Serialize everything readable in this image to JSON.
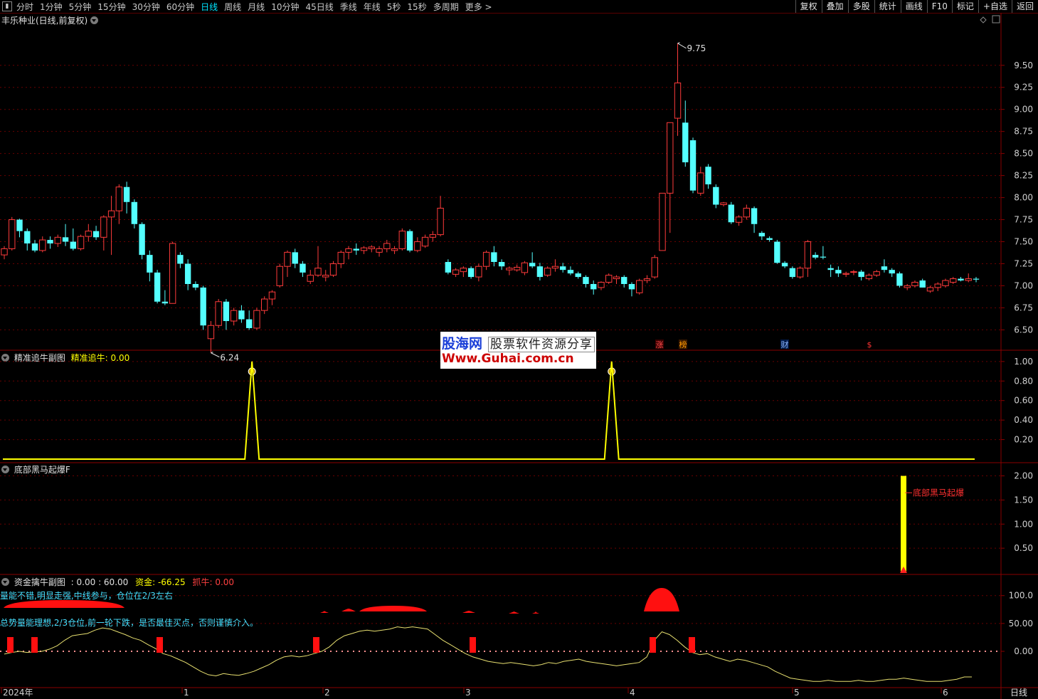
{
  "toolbar": {
    "left_items": [
      "分时",
      "1分钟",
      "5分钟",
      "15分钟",
      "30分钟",
      "60分钟",
      "日线",
      "周线",
      "月线",
      "10分钟",
      "45日线",
      "季线",
      "年线",
      "5秒",
      "15秒",
      "多周期",
      "更多 >"
    ],
    "active_item": "日线",
    "right_items": [
      "复权",
      "叠加",
      "多股",
      "统计",
      "画线",
      "F10",
      "标记",
      "+自选",
      "返回"
    ]
  },
  "main_panel": {
    "title": "丰乐种业(日线,前复权)",
    "high_label": "9.75",
    "low_label": "6.24",
    "event_markers": [
      {
        "text": "涨",
        "color": "#ff4d4d",
        "bg": "#3a0000"
      },
      {
        "text": "榜",
        "color": "#ff9900",
        "bg": "#3a1a00"
      },
      {
        "text": "财",
        "color": "#8fb7ff",
        "bg": "#001a4a"
      },
      {
        "text": "$",
        "color": "#ff3333",
        "bg": "#000000"
      }
    ]
  },
  "panel2": {
    "name": "精准追牛副图",
    "value_label": "精准追牛: 0.00",
    "axis_labels": [
      "1.00",
      "0.80",
      "0.60",
      "0.40",
      "0.20"
    ]
  },
  "panel3": {
    "name": "底部黑马起爆F",
    "annotation": "底部黑马起爆",
    "axis_labels": [
      "2.00",
      "1.50",
      "1.00",
      "0.50"
    ]
  },
  "panel4": {
    "name": "资金擒牛副图",
    "values_label": ": 0.00 : 60.00",
    "fund_label": "资金: -66.25",
    "catch_label": "抓牛: 0.00",
    "note1": "量能不错,明显走强,中线参与，仓位在2/3左右",
    "note2": "总势量能理想,2/3仓位,前一轮下跌，是否最佳买点，否则谨慎介入。",
    "axis_labels": [
      "100.0",
      "50.00",
      "0.00"
    ]
  },
  "x_axis": {
    "labels": [
      "2024年",
      "1",
      "2",
      "3",
      "4",
      "5",
      "6"
    ],
    "right_label": "日线"
  },
  "watermark": {
    "line1": "股海网",
    "line1b": "股票软件资源分享",
    "line2": "Www.Guhai.com.cn"
  },
  "colors": {
    "up": "#ff3b3b",
    "down": "#54ffff",
    "yellow": "#ffff00",
    "grid": "#6a0000",
    "axis_text": "#d0d0d0"
  },
  "chart_data": [
    {
      "type": "candlestick",
      "title": "丰乐种业(日线,前复权)",
      "y_ticks": [
        9.5,
        9.25,
        9.0,
        8.75,
        8.5,
        8.25,
        8.0,
        7.75,
        7.5,
        7.25,
        7.0,
        6.75,
        6.5
      ],
      "ylim": [
        6.35,
        9.95
      ],
      "high": 9.75,
      "low": 6.24,
      "ohlc": [
        [
          7.35,
          7.45,
          7.3,
          7.42
        ],
        [
          7.42,
          7.78,
          7.4,
          7.75
        ],
        [
          7.75,
          7.76,
          7.55,
          7.62
        ],
        [
          7.62,
          7.65,
          7.4,
          7.48
        ],
        [
          7.48,
          7.52,
          7.38,
          7.4
        ],
        [
          7.4,
          7.56,
          7.38,
          7.52
        ],
        [
          7.52,
          7.56,
          7.42,
          7.48
        ],
        [
          7.48,
          7.58,
          7.44,
          7.55
        ],
        [
          7.55,
          7.7,
          7.45,
          7.5
        ],
        [
          7.5,
          7.65,
          7.4,
          7.42
        ],
        [
          7.42,
          7.58,
          7.4,
          7.56
        ],
        [
          7.56,
          7.7,
          7.5,
          7.62
        ],
        [
          7.62,
          7.68,
          7.52,
          7.55
        ],
        [
          7.55,
          7.8,
          7.4,
          7.78
        ],
        [
          7.78,
          8.02,
          7.35,
          7.85
        ],
        [
          7.85,
          8.15,
          7.7,
          8.12
        ],
        [
          8.12,
          8.18,
          7.82,
          7.95
        ],
        [
          7.95,
          7.98,
          7.65,
          7.7
        ],
        [
          7.7,
          7.72,
          7.3,
          7.35
        ],
        [
          7.35,
          7.4,
          7.05,
          7.15
        ],
        [
          7.15,
          7.18,
          6.8,
          6.82
        ],
        [
          6.82,
          6.95,
          6.78,
          6.8
        ],
        [
          6.8,
          7.5,
          6.85,
          7.48
        ],
        [
          7.35,
          7.38,
          7.2,
          7.25
        ],
        [
          7.25,
          7.3,
          6.95,
          7.02
        ],
        [
          7.02,
          7.05,
          6.95,
          6.98
        ],
        [
          6.98,
          7.0,
          6.5,
          6.55
        ],
        [
          6.4,
          6.6,
          6.24,
          6.55
        ],
        [
          6.55,
          6.85,
          6.52,
          6.82
        ],
        [
          6.82,
          6.85,
          6.5,
          6.6
        ],
        [
          6.6,
          6.75,
          6.55,
          6.72
        ],
        [
          6.72,
          6.78,
          6.58,
          6.62
        ],
        [
          6.62,
          6.72,
          6.5,
          6.52
        ],
        [
          6.52,
          6.75,
          6.5,
          6.72
        ],
        [
          6.72,
          6.88,
          6.68,
          6.85
        ],
        [
          6.85,
          6.95,
          6.78,
          6.93
        ],
        [
          7.0,
          7.25,
          6.98,
          7.22
        ],
        [
          7.22,
          7.4,
          7.1,
          7.38
        ],
        [
          7.38,
          7.42,
          7.2,
          7.25
        ],
        [
          7.25,
          7.28,
          7.1,
          7.15
        ],
        [
          7.05,
          7.18,
          7.02,
          7.12
        ],
        [
          7.12,
          7.45,
          7.1,
          7.2
        ],
        [
          7.1,
          7.18,
          7.05,
          7.12
        ],
        [
          7.12,
          7.28,
          7.1,
          7.25
        ],
        [
          7.25,
          7.4,
          7.2,
          7.38
        ],
        [
          7.38,
          7.45,
          7.3,
          7.42
        ],
        [
          7.42,
          7.48,
          7.35,
          7.4
        ],
        [
          7.4,
          7.45,
          7.36,
          7.43
        ],
        [
          7.42,
          7.46,
          7.38,
          7.44
        ],
        [
          7.38,
          7.45,
          7.33,
          7.42
        ],
        [
          7.42,
          7.52,
          7.38,
          7.48
        ],
        [
          7.4,
          7.45,
          7.36,
          7.42
        ],
        [
          7.42,
          7.65,
          7.4,
          7.62
        ],
        [
          7.62,
          7.64,
          7.38,
          7.4
        ],
        [
          7.4,
          7.55,
          7.38,
          7.5
        ],
        [
          7.45,
          7.58,
          7.43,
          7.55
        ],
        [
          7.55,
          7.62,
          7.5,
          7.58
        ],
        [
          7.58,
          8.02,
          7.56,
          7.88
        ],
        [
          7.27,
          7.3,
          7.13,
          7.15
        ],
        [
          7.13,
          7.2,
          7.1,
          7.18
        ],
        [
          7.16,
          7.22,
          7.1,
          7.2
        ],
        [
          7.2,
          7.22,
          7.08,
          7.1
        ],
        [
          7.1,
          7.25,
          7.05,
          7.22
        ],
        [
          7.22,
          7.4,
          7.18,
          7.38
        ],
        [
          7.38,
          7.45,
          7.22,
          7.27
        ],
        [
          7.27,
          7.3,
          7.18,
          7.22
        ],
        [
          7.18,
          7.22,
          7.12,
          7.2
        ],
        [
          7.18,
          7.24,
          7.16,
          7.21
        ],
        [
          7.15,
          7.28,
          7.12,
          7.26
        ],
        [
          7.26,
          7.38,
          7.2,
          7.22
        ],
        [
          7.22,
          7.26,
          7.06,
          7.1
        ],
        [
          7.12,
          7.22,
          7.1,
          7.2
        ],
        [
          7.2,
          7.3,
          7.16,
          7.22
        ],
        [
          7.22,
          7.26,
          7.15,
          7.18
        ],
        [
          7.18,
          7.22,
          7.12,
          7.14
        ],
        [
          7.14,
          7.16,
          7.08,
          7.1
        ],
        [
          7.1,
          7.12,
          6.98,
          7.02
        ],
        [
          7.02,
          7.06,
          6.9,
          6.96
        ],
        [
          6.98,
          7.05,
          6.95,
          7.04
        ],
        [
          7.04,
          7.14,
          7.02,
          7.12
        ],
        [
          7.08,
          7.12,
          7.02,
          7.1
        ],
        [
          7.1,
          7.12,
          6.98,
          7.02
        ],
        [
          7.02,
          7.04,
          6.88,
          6.96
        ],
        [
          6.92,
          7.08,
          6.9,
          7.06
        ],
        [
          7.06,
          7.12,
          7.03,
          7.08
        ],
        [
          7.1,
          7.35,
          7.08,
          7.32
        ],
        [
          7.4,
          8.05,
          7.5,
          8.05
        ],
        [
          8.05,
          8.85,
          7.6,
          8.85
        ],
        [
          8.9,
          9.75,
          8.7,
          9.3
        ],
        [
          8.85,
          9.1,
          8.35,
          8.4
        ],
        [
          8.65,
          8.68,
          8.05,
          8.08
        ],
        [
          8.05,
          8.35,
          8.02,
          8.28
        ],
        [
          8.35,
          8.38,
          8.1,
          8.15
        ],
        [
          8.12,
          8.15,
          7.88,
          7.92
        ],
        [
          7.92,
          7.95,
          7.9,
          7.94
        ],
        [
          7.92,
          7.95,
          7.7,
          7.72
        ],
        [
          7.72,
          7.8,
          7.68,
          7.78
        ],
        [
          7.78,
          7.92,
          7.75,
          7.88
        ],
        [
          7.88,
          7.9,
          7.6,
          7.7
        ],
        [
          7.6,
          7.62,
          7.52,
          7.56
        ],
        [
          7.54,
          7.56,
          7.5,
          7.52
        ],
        [
          7.5,
          7.52,
          7.25,
          7.26
        ],
        [
          7.26,
          7.28,
          7.2,
          7.22
        ],
        [
          7.2,
          7.22,
          7.08,
          7.1
        ],
        [
          7.1,
          7.22,
          7.08,
          7.2
        ],
        [
          7.2,
          7.52,
          7.1,
          7.5
        ],
        [
          7.35,
          7.38,
          7.3,
          7.32
        ],
        [
          7.33,
          7.45,
          7.3,
          7.32
        ],
        [
          7.2,
          7.24,
          7.1,
          7.18
        ],
        [
          7.18,
          7.22,
          7.1,
          7.14
        ],
        [
          7.13,
          7.16,
          7.1,
          7.14
        ],
        [
          7.16,
          7.18,
          7.12,
          7.16
        ],
        [
          7.16,
          7.18,
          7.06,
          7.1
        ],
        [
          7.08,
          7.14,
          7.06,
          7.12
        ],
        [
          7.12,
          7.18,
          7.1,
          7.16
        ],
        [
          7.22,
          7.3,
          7.15,
          7.18
        ],
        [
          7.18,
          7.2,
          7.1,
          7.14
        ],
        [
          7.14,
          7.16,
          6.98,
          7.0
        ],
        [
          6.98,
          7.02,
          6.95,
          7.0
        ],
        [
          7.0,
          7.06,
          6.98,
          7.04
        ],
        [
          7.06,
          7.08,
          6.98,
          6.98
        ],
        [
          6.94,
          7.0,
          6.92,
          6.98
        ],
        [
          6.98,
          7.04,
          6.94,
          7.02
        ],
        [
          7.0,
          7.08,
          6.98,
          7.06
        ],
        [
          7.04,
          7.1,
          7.02,
          7.08
        ],
        [
          7.08,
          7.1,
          7.05,
          7.06
        ],
        [
          7.06,
          7.14,
          7.04,
          7.08
        ],
        [
          7.08,
          7.1,
          7.04,
          7.07
        ]
      ]
    },
    {
      "type": "line",
      "title": "精准追牛副图",
      "ylim": [
        0,
        1.05
      ],
      "series": [
        {
          "name": "精准追牛",
          "values_spikes": [
            {
              "index": 32,
              "value": 1.0
            },
            {
              "index": 79,
              "value": 1.0
            }
          ],
          "baseline": 0
        }
      ]
    },
    {
      "type": "bar",
      "title": "底部黑马起爆F",
      "ylim": [
        0,
        2.2
      ],
      "series": [
        {
          "name": "底部黑马起爆",
          "bars": [
            {
              "index": 110,
              "value": 2.0
            }
          ]
        }
      ]
    },
    {
      "type": "line",
      "title": "资金擒牛副图",
      "ylim": [
        -60,
        115
      ],
      "series": [
        {
          "name": "资金",
          "values": [
            -5,
            -2,
            0,
            -2,
            -1,
            0,
            4,
            10,
            20,
            28,
            30,
            32,
            38,
            42,
            40,
            35,
            30,
            24,
            20,
            12,
            5,
            -4,
            -8,
            -14,
            -20,
            -28,
            -36,
            -42,
            -44,
            -40,
            -42,
            -43,
            -40,
            -36,
            -30,
            -24,
            -16,
            -10,
            -8,
            -10,
            -8,
            -4,
            0,
            8,
            20,
            28,
            32,
            36,
            38,
            36,
            38,
            40,
            44,
            42,
            44,
            42,
            40,
            30,
            20,
            12,
            4,
            -4,
            -10,
            -14,
            -18,
            -20,
            -22,
            -20,
            -22,
            -24,
            -26,
            -24,
            -20,
            -22,
            -18,
            -16,
            -14,
            -18,
            -20,
            -22,
            -24,
            -26,
            -24,
            -22,
            -20,
            -10,
            20,
            35,
            30,
            20,
            8,
            -2,
            -6,
            -4,
            -10,
            -14,
            -18,
            -14,
            -16,
            -20,
            -24,
            -28,
            -36,
            -42,
            -48,
            -50,
            -52,
            -54,
            -54,
            -52,
            -54,
            -54,
            -54,
            -52,
            -54,
            -54,
            -52,
            -50,
            -50,
            -48,
            -50,
            -52,
            -54,
            -54,
            -54,
            -52,
            -50,
            -46,
            -46
          ]
        },
        {
          "name": "抓牛",
          "markers_index": [
            2,
            6,
            31,
            62,
            80,
            85
          ]
        }
      ]
    }
  ]
}
